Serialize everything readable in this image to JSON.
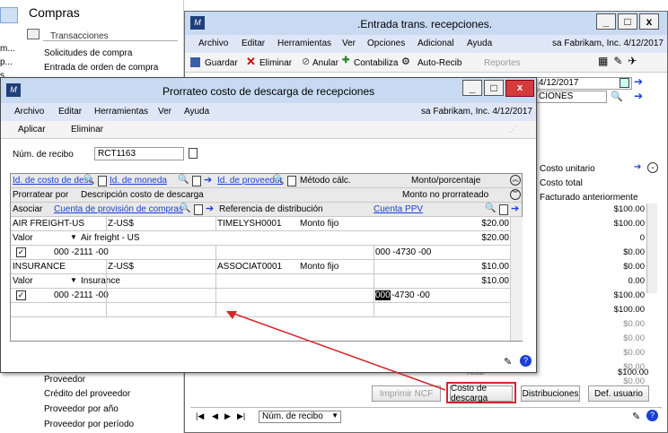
{
  "nav": {
    "header": "Compras",
    "section": "Transacciones",
    "items_top": [
      "Solicitudes de compra",
      "Entrada de orden de compra"
    ],
    "items_bottom": [
      "Proveedor",
      "Crédito del proveedor",
      "Proveedor por año",
      "Proveedor por período"
    ],
    "left_fragments": [
      "m...",
      "p...",
      "s..."
    ]
  },
  "bg_window": {
    "title": ".Entrada trans. recepciones.",
    "menu": [
      "Archivo",
      "Editar",
      "Herramientas",
      "Ver",
      "Opciones",
      "Adicional",
      "Ayuda"
    ],
    "company": "sa  Fabrikam, Inc.  4/12/2017",
    "toolbar": {
      "save": "Guardar",
      "delete": "Eliminar",
      "void": "Anular",
      "post": "Contabiliza",
      "autorcv": "Auto-Recib",
      "reports": "Reportes"
    },
    "date_frag": "4/12/2017",
    "desc_frag": "CIONES",
    "col_unit_cost": "Costo unitario",
    "col_total_cost": "Costo total",
    "col_billed": "Facturado anteriormente",
    "values": [
      "$100.00",
      "$100.00",
      "0",
      "$0.00",
      "$0.00",
      "0.00",
      "$100.00",
      "$100.00",
      "$0.00",
      "$0.00",
      "$0.00",
      "$0.00",
      "$0.00",
      "$100.00"
    ],
    "buttons": {
      "imprimir": "Imprimir NCF",
      "costo": "Costo de descarga",
      "distrib": "Distribuciones",
      "def": "Def. usuario"
    },
    "nav_sort": "Núm. de recibo",
    "total_frag": "Total"
  },
  "fg_window": {
    "title": "Prorrateo costo de descarga de recepciones",
    "menu": [
      "Archivo",
      "Editar",
      "Herramientas",
      "Ver",
      "Ayuda"
    ],
    "company": "sa  Fabrikam, Inc.  4/12/2017",
    "toolbar": {
      "apply": "Aplicar",
      "delete": "Eliminar"
    },
    "receipt_label": "Núm. de recibo",
    "receipt_value": "RCT1163",
    "headers": {
      "h1": "Id. de costo de desc",
      "h2": "Id. de moneda",
      "h3": "Id. de proveedor",
      "h4": "Método cálc.",
      "h5": "Monto/porcentaje",
      "h6": "Prorratear por",
      "h7": "Descripción costo de descarga",
      "h8": "Monto no prorrateado",
      "h9": "Asociar",
      "h10": "Cuenta de provisión de compras",
      "h11": "Referencia de distribución",
      "h12": "Cuenta PPV"
    },
    "lines": [
      {
        "id": "AIR FREIGHT-US",
        "currency": "Z-US$",
        "vendor": "TIMELYSH0001",
        "method": "Monto fijo",
        "amount": "$20.00",
        "allocate": "Valor",
        "desc": "Air freight - US",
        "unallocated": "$20.00",
        "accrual": "000 -2111 -00",
        "ppv": "000 -4730 -00"
      },
      {
        "id": "INSURANCE",
        "currency": "Z-US$",
        "vendor": "ASSOCIAT0001",
        "method": "Monto fijo",
        "amount": "$10.00",
        "allocate": "Valor",
        "desc": "Insurance",
        "unallocated": "$10.00",
        "accrual": "000 -2111 -00",
        "ppv_hl": "000",
        "ppv_rest": " -4730 -00"
      }
    ]
  },
  "colors": {
    "titlebar": "#c7daf2",
    "menubar": "#dfe7f7",
    "accent": "#1a3fd8",
    "highlight": "#d4252a"
  }
}
